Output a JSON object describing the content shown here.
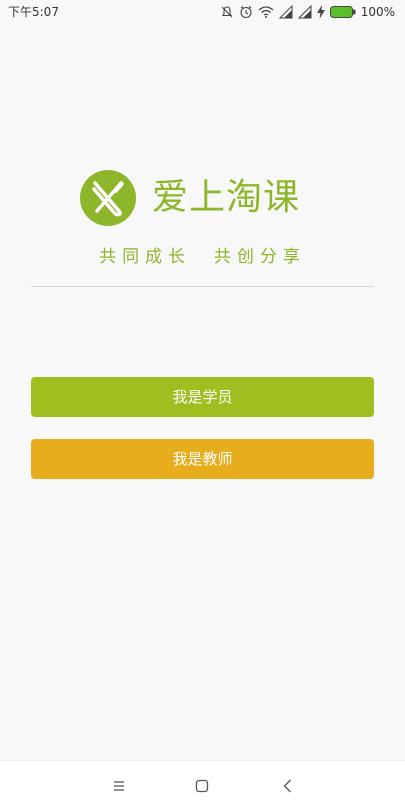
{
  "status_bar": {
    "time": "下午5:07",
    "battery": "100%",
    "icons": [
      "mute-icon",
      "alarm-icon",
      "wifi-icon",
      "signal-icon",
      "signal-icon",
      "charging-icon",
      "battery-icon"
    ]
  },
  "brand": {
    "name": "爱上淘课",
    "slogan": "共同成长  共创分享",
    "logo_icon": "cross-logo-icon"
  },
  "buttons": {
    "student": "我是学员",
    "teacher": "我是教师"
  },
  "nav": {
    "icons": [
      "menu-icon",
      "home-icon",
      "back-icon"
    ]
  },
  "colors": {
    "brand_green": "#8db62a",
    "student_button": "#a0be1f",
    "teacher_button": "#e8ad1c",
    "background": "#f8f8f8"
  }
}
